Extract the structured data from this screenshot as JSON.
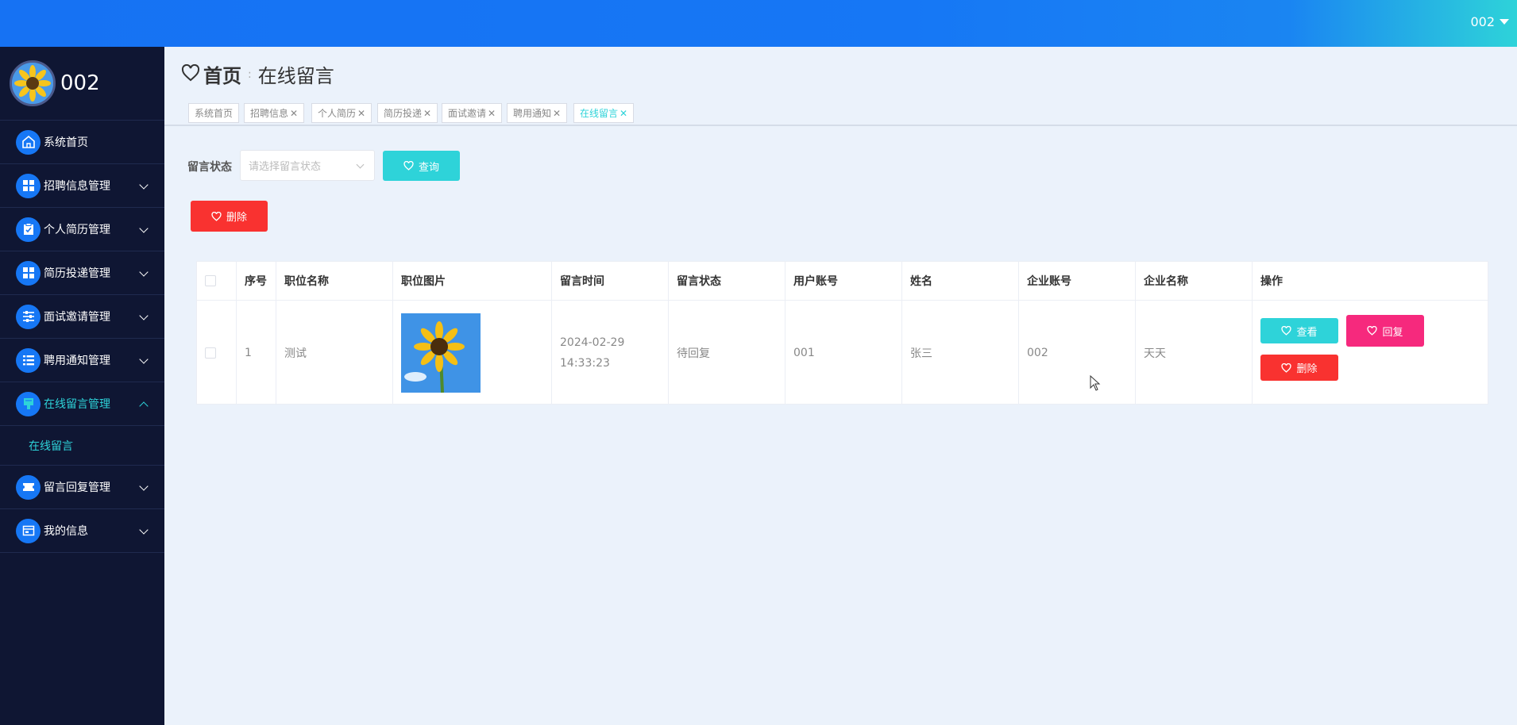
{
  "header": {
    "user_name": "002"
  },
  "sidebar": {
    "profile_name": "002",
    "items": [
      {
        "label": "系统首页",
        "icon": "home-icon"
      },
      {
        "label": "招聘信息管理",
        "icon": "grid-icon"
      },
      {
        "label": "个人简历管理",
        "icon": "clipboard-icon"
      },
      {
        "label": "简历投递管理",
        "icon": "grid-icon"
      },
      {
        "label": "面试邀请管理",
        "icon": "sliders-icon"
      },
      {
        "label": "聘用通知管理",
        "icon": "list-icon"
      },
      {
        "label": "在线留言管理",
        "icon": "message-icon"
      },
      {
        "label": "留言回复管理",
        "icon": "ticket-icon"
      },
      {
        "label": "我的信息",
        "icon": "card-icon"
      }
    ],
    "submenu": {
      "label": "在线留言"
    }
  },
  "breadcrumb": {
    "home": "首页",
    "current": "在线留言"
  },
  "tags": [
    {
      "label": "系统首页",
      "closable": false
    },
    {
      "label": "招聘信息",
      "closable": true
    },
    {
      "label": "个人简历",
      "closable": true
    },
    {
      "label": "简历投递",
      "closable": true
    },
    {
      "label": "面试邀请",
      "closable": true
    },
    {
      "label": "聘用通知",
      "closable": true
    },
    {
      "label": "在线留言",
      "closable": true,
      "active": true
    }
  ],
  "filter": {
    "label": "留言状态",
    "placeholder": "请选择留言状态",
    "query_label": "查询",
    "delete_label": "删除"
  },
  "table": {
    "headers": [
      "序号",
      "职位名称",
      "职位图片",
      "留言时间",
      "留言状态",
      "用户账号",
      "姓名",
      "企业账号",
      "企业名称",
      "操作"
    ],
    "rows": [
      {
        "index": "1",
        "job_name": "测试",
        "time": "2024-02-29 14:33:23",
        "status": "待回复",
        "user_account": "001",
        "name": "张三",
        "company_account": "002",
        "company_name": "天天"
      }
    ],
    "actions": {
      "view": "查看",
      "reply": "回复",
      "delete": "删除"
    }
  },
  "colors": {
    "accent": "#2ed3d9",
    "primary": "#1677f5",
    "danger": "#f93230",
    "pink": "#f6297d",
    "sidebar_bg": "#0f1633"
  }
}
